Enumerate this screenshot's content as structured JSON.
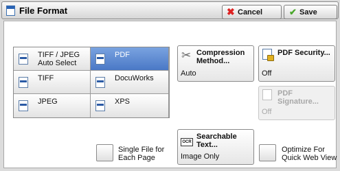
{
  "header": {
    "title": "File Format",
    "cancel_label": "Cancel",
    "save_label": "Save"
  },
  "formats": [
    {
      "label": "TIFF / JPEG Auto Select",
      "line1": "TIFF / JPEG",
      "line2": "Auto Select",
      "selected": false,
      "icon": "tiff-jpeg-auto-icon"
    },
    {
      "label": "PDF",
      "selected": true,
      "icon": "pdf-icon"
    },
    {
      "label": "TIFF",
      "selected": false,
      "icon": "tiff-icon"
    },
    {
      "label": "DocuWorks",
      "selected": false,
      "icon": "docuworks-icon"
    },
    {
      "label": "JPEG",
      "selected": false,
      "icon": "jpeg-icon"
    },
    {
      "label": "XPS",
      "selected": false,
      "icon": "xps-icon"
    }
  ],
  "compression": {
    "line1": "Compression",
    "line2": "Method...",
    "value": "Auto"
  },
  "pdf_security": {
    "label": "PDF Security...",
    "value": "Off"
  },
  "pdf_signature": {
    "label": "PDF Signature...",
    "value": "Off",
    "disabled": true
  },
  "searchable": {
    "line1": "Searchable",
    "line2": "Text...",
    "value": "Image Only",
    "icon_text": "OCR"
  },
  "single_file": {
    "line1": "Single File for",
    "line2": "Each Page",
    "checked": false
  },
  "optimize": {
    "line1": "Optimize For",
    "line2": "Quick Web View",
    "checked": false
  },
  "colors": {
    "selected": "#4a78c6",
    "cancel_x": "#d22222",
    "save_check": "#4aa72b"
  }
}
